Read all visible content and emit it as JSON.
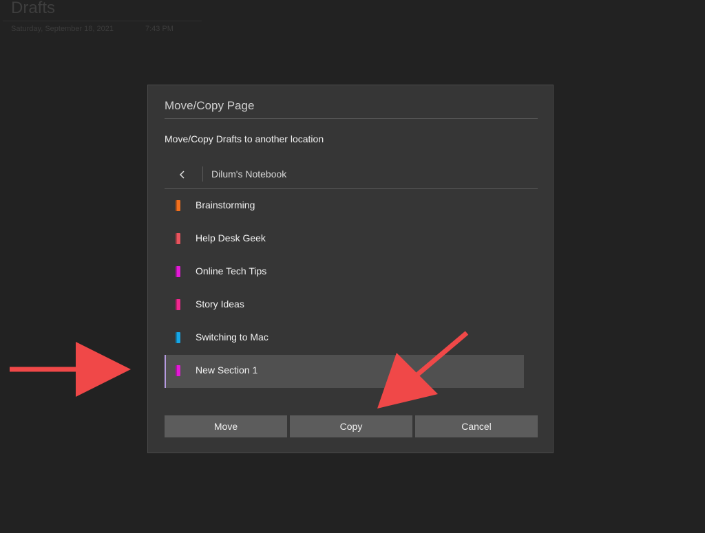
{
  "page": {
    "title": "Drafts",
    "date": "Saturday, September 18, 2021",
    "time": "7:43 PM"
  },
  "dialog": {
    "title": "Move/Copy Page",
    "subtitle": "Move/Copy Drafts to another location",
    "back_icon": "chevron-left-icon",
    "notebook": "Dilum's Notebook",
    "sections": [
      {
        "label": "Brainstorming",
        "color": "#f2701e"
      },
      {
        "label": "Help Desk Geek",
        "color": "#e8545e"
      },
      {
        "label": "Online Tech Tips",
        "color": "#e21bd6"
      },
      {
        "label": "Story Ideas",
        "color": "#f0288e"
      },
      {
        "label": "Switching to Mac",
        "color": "#16a6e6"
      },
      {
        "label": "New Section 1",
        "color": "#e21bd6",
        "selected": true
      }
    ],
    "buttons": {
      "move": "Move",
      "copy": "Copy",
      "cancel": "Cancel"
    }
  },
  "annotations": {
    "arrow_color": "#f04848"
  }
}
